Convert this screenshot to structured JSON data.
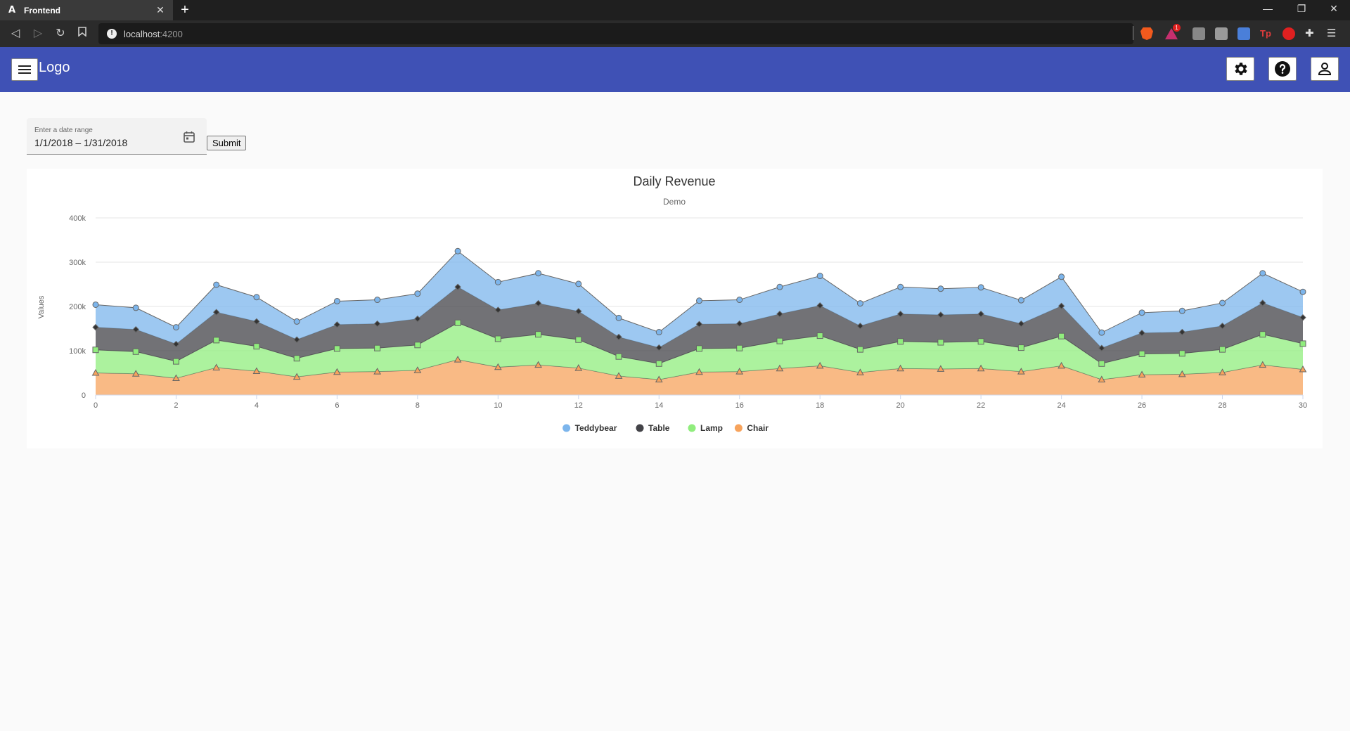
{
  "browser": {
    "tab_title": "Frontend",
    "tab_favicon": "A",
    "url_host": "localhost",
    "url_port": ":4200",
    "notification_count": "1"
  },
  "toolbar": {
    "logo": "Logo",
    "icons": [
      "menu-icon",
      "gear-icon",
      "help-icon",
      "user-icon"
    ]
  },
  "form": {
    "date_label": "Enter a date range",
    "date_value": "1/1/2018 – 1/31/2018",
    "submit_label": "Submit"
  },
  "chart_data": {
    "type": "area",
    "stacked": true,
    "title": "Daily Revenue",
    "subtitle": "Demo",
    "xlabel": "",
    "ylabel": "Values",
    "xlim": [
      0,
      30
    ],
    "ylim": [
      0,
      400000
    ],
    "x_ticks": [
      "0",
      "2",
      "4",
      "6",
      "8",
      "10",
      "12",
      "14",
      "16",
      "18",
      "20",
      "22",
      "24",
      "26",
      "28",
      "30"
    ],
    "y_ticks": [
      "0",
      "100k",
      "200k",
      "300k",
      "400k"
    ],
    "grid": true,
    "legend_position": "bottom",
    "x": [
      0,
      1,
      2,
      3,
      4,
      5,
      6,
      7,
      8,
      9,
      10,
      11,
      12,
      13,
      14,
      15,
      16,
      17,
      18,
      19,
      20,
      21,
      22,
      23,
      24,
      25,
      26,
      27,
      28,
      29,
      30
    ],
    "series": [
      {
        "name": "Chair",
        "color": "#f7a35c",
        "marker": "triangle",
        "values": [
          50000,
          48000,
          38000,
          62000,
          54000,
          41000,
          52000,
          53000,
          56000,
          80000,
          63000,
          68000,
          61000,
          43000,
          35000,
          52000,
          53000,
          60000,
          66000,
          51000,
          60000,
          59000,
          60000,
          53000,
          66000,
          35000,
          46000,
          47000,
          51000,
          68000,
          58000
        ]
      },
      {
        "name": "Lamp",
        "color": "#90ed7d",
        "marker": "square",
        "values": [
          52000,
          50000,
          38000,
          62000,
          56000,
          42000,
          53000,
          53000,
          57000,
          83000,
          64000,
          69000,
          64000,
          44000,
          36000,
          53000,
          53000,
          62000,
          68000,
          52000,
          61000,
          60000,
          61000,
          54000,
          67000,
          36000,
          47000,
          47000,
          52000,
          69000,
          58000
        ]
      },
      {
        "name": "Table",
        "color": "#434348",
        "marker": "diamond",
        "values": [
          51000,
          50000,
          39000,
          63000,
          56000,
          42000,
          54000,
          55000,
          59000,
          81000,
          65000,
          70000,
          64000,
          44000,
          36000,
          55000,
          55000,
          61000,
          68000,
          53000,
          62000,
          62000,
          62000,
          54000,
          68000,
          35000,
          47000,
          48000,
          53000,
          71000,
          59000
        ]
      },
      {
        "name": "Teddybear",
        "color": "#7cb5ec",
        "marker": "circle",
        "values": [
          51000,
          49000,
          38000,
          62000,
          55000,
          41000,
          53000,
          54000,
          57000,
          81000,
          63000,
          68000,
          62000,
          43000,
          35000,
          53000,
          54000,
          61000,
          67000,
          51000,
          61000,
          59000,
          60000,
          53000,
          66000,
          35000,
          46000,
          48000,
          52000,
          67000,
          58000
        ]
      }
    ],
    "legend_order": [
      "Teddybear",
      "Table",
      "Lamp",
      "Chair"
    ]
  }
}
